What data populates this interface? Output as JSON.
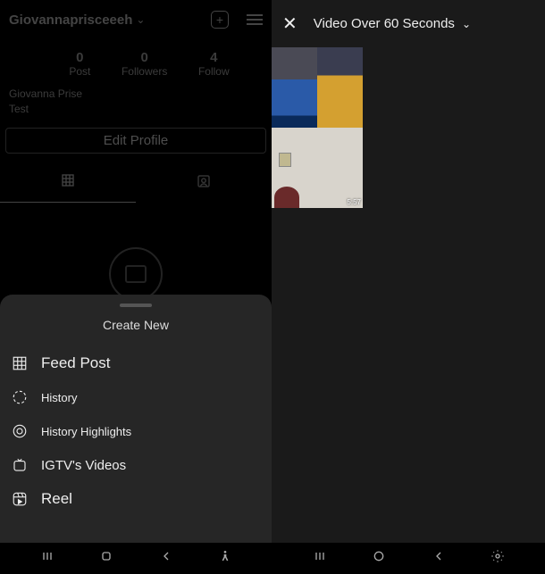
{
  "left": {
    "username": "Giovannaprisceeeh",
    "stats": [
      {
        "num": "0",
        "label": "Post"
      },
      {
        "num": "0",
        "label": "Followers"
      },
      {
        "num": "4",
        "label": "Follow"
      }
    ],
    "bio_name": "Giovanna Prise",
    "bio_text": "Test",
    "edit_profile": "Edit Profile"
  },
  "sheet": {
    "title": "Create New",
    "items": [
      {
        "label": "Feed Post"
      },
      {
        "label": "History"
      },
      {
        "label": "History Highlights"
      },
      {
        "label": "IGTV's Videos"
      },
      {
        "label": "Reel"
      }
    ]
  },
  "right": {
    "title": "Video Over 60 Seconds",
    "thumbs": [
      {
        "duration": ""
      },
      {
        "duration": ""
      },
      {
        "duration": ""
      },
      {
        "duration": "5:57"
      }
    ]
  }
}
